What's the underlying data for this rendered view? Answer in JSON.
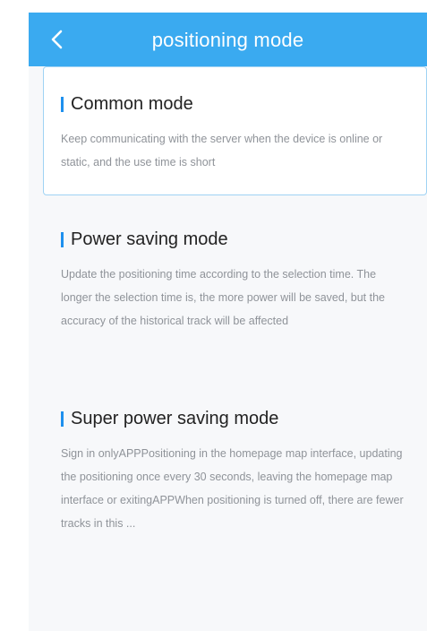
{
  "header": {
    "title": "positioning mode",
    "back_icon": "chevron-left-icon",
    "background_color": "#3aaaf0"
  },
  "modes": [
    {
      "title": "Common mode",
      "description": "Keep communicating with the server when the device is online or static, and the use time is short",
      "selected": true
    },
    {
      "title": "Power saving mode",
      "description": "Update the positioning time according to the selection time. The longer the selection time is, the more power will be saved, but the accuracy of the historical track will be affected",
      "selected": false
    },
    {
      "title": "Super power saving mode",
      "description": "Sign in onlyAPPPositioning in the homepage map interface, updating the positioning once every 30 seconds, leaving the homepage map interface or exitingAPPWhen positioning is turned off, there are fewer tracks in this ...",
      "selected": false
    }
  ],
  "accent_color": "#1e90ee"
}
